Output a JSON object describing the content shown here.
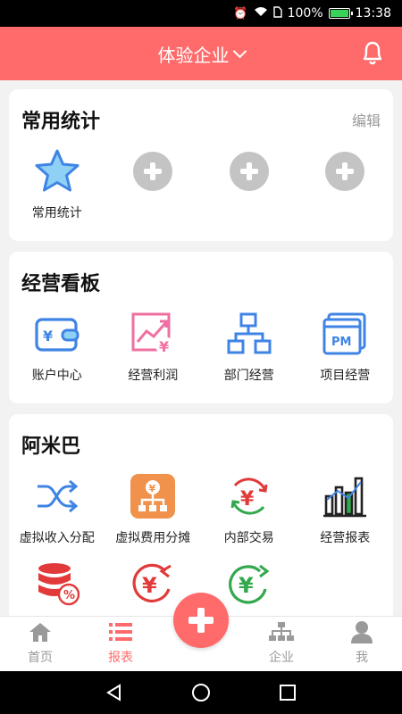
{
  "status_bar": {
    "battery": "100%",
    "time": "13:38",
    "battery_level": 1.0
  },
  "header": {
    "title": "体验企业"
  },
  "common_stats": {
    "title": "常用统计",
    "edit_label": "编辑",
    "items": [
      {
        "label": "常用统计",
        "icon": "star-icon"
      }
    ],
    "placeholders": 3
  },
  "business_board": {
    "title": "经营看板",
    "items": [
      {
        "label": "账户中心",
        "icon": "wallet-icon"
      },
      {
        "label": "经营利润",
        "icon": "profit-chart-icon"
      },
      {
        "label": "部门经营",
        "icon": "org-chart-icon"
      },
      {
        "label": "项目经营",
        "icon": "pm-window-icon"
      }
    ]
  },
  "amoeba": {
    "title": "阿米巴",
    "items": [
      {
        "label": "虚拟收入分配",
        "icon": "shuffle-icon"
      },
      {
        "label": "虚拟费用分摊",
        "icon": "fee-distribute-icon"
      },
      {
        "label": "内部交易",
        "icon": "yen-exchange-icon"
      },
      {
        "label": "经营报表",
        "icon": "bar-report-icon"
      },
      {
        "label": "",
        "icon": "database-percent-icon"
      },
      {
        "label": "",
        "icon": "yen-in-icon"
      },
      {
        "label": "",
        "icon": "yen-out-icon"
      }
    ]
  },
  "tabs": [
    {
      "label": "首页",
      "icon": "home-icon"
    },
    {
      "label": "报表",
      "icon": "list-icon",
      "active": true
    },
    {
      "label": "企业",
      "icon": "enterprise-icon"
    },
    {
      "label": "我",
      "icon": "user-icon"
    }
  ],
  "colors": {
    "accent": "#ff6b6b",
    "blue": "#3f84e5",
    "pink": "#ef6fa1",
    "orange": "#f0924b",
    "red": "#e23a3a",
    "green": "#33a84d"
  }
}
